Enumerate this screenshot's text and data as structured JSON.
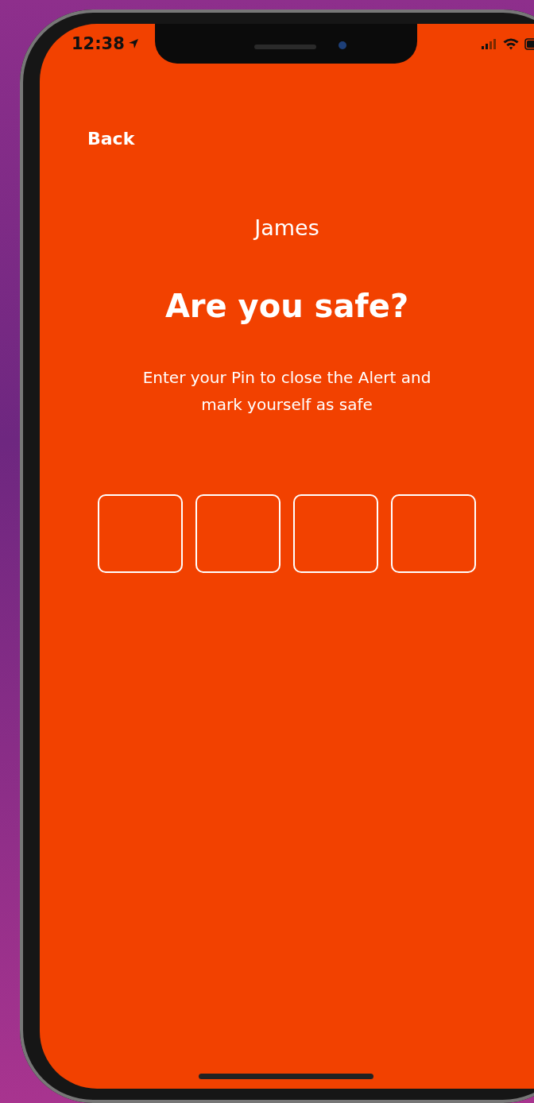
{
  "status_bar": {
    "time": "12:38"
  },
  "nav": {
    "back": "Back"
  },
  "name": "James",
  "title": "Are you safe?",
  "message": "Enter your Pin to close the Alert and mark yourself as safe",
  "pin_fields": [
    {
      "filled": false
    },
    {
      "filled": false
    },
    {
      "filled": false
    },
    {
      "filled": false
    }
  ]
}
